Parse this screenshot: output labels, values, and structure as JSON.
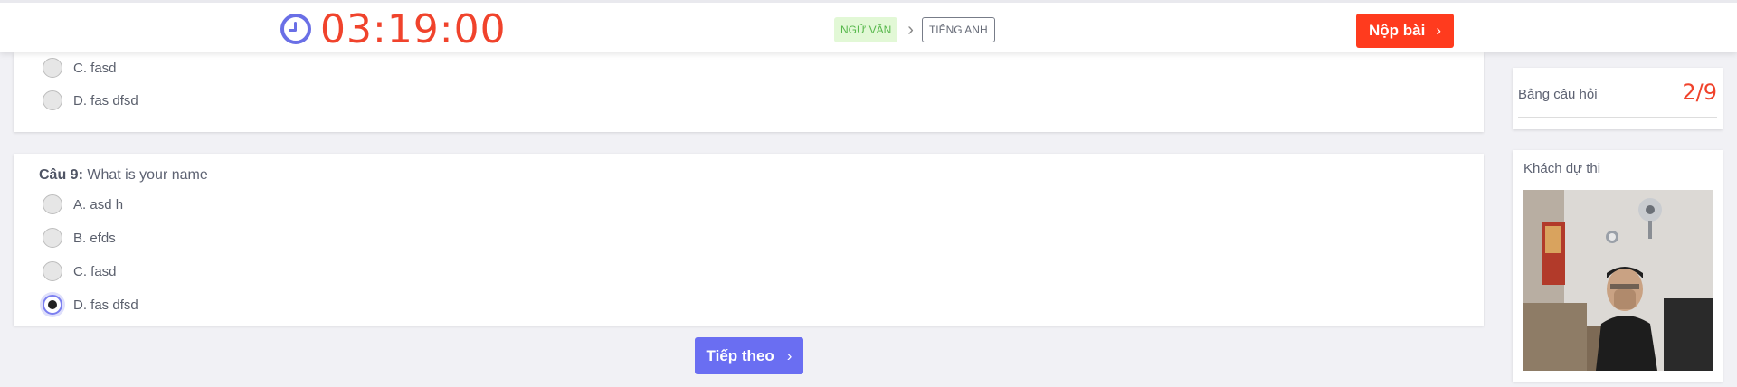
{
  "header": {
    "timer": "03:19:00",
    "subjects": [
      {
        "label": "NGỮ VĂN",
        "active": true
      },
      {
        "label": "TIẾNG ANH",
        "active": false
      }
    ],
    "submit_label": "Nộp bài"
  },
  "previous_question": {
    "options": [
      {
        "letter": "C.",
        "text": "fasd",
        "selected": false
      },
      {
        "letter": "D.",
        "text": "fas dfsd",
        "selected": false
      }
    ]
  },
  "question": {
    "number_label": "Câu 9:",
    "text": "What is your name",
    "options": [
      {
        "letter": "A.",
        "text": "asd h",
        "selected": false
      },
      {
        "letter": "B.",
        "text": "efds",
        "selected": false
      },
      {
        "letter": "C.",
        "text": "fasd",
        "selected": false
      },
      {
        "letter": "D.",
        "text": "fas dfsd",
        "selected": true
      }
    ]
  },
  "next_label": "Tiếp theo",
  "sidebar": {
    "question_board_label": "Bảng câu hỏi",
    "question_count": "2/9",
    "guest_label": "Khách dự thi"
  },
  "colors": {
    "accent": "#6a6ef2",
    "danger": "#f0432c",
    "submit": "#ff3b1e",
    "active_subject_bg": "#e2f8d6"
  }
}
